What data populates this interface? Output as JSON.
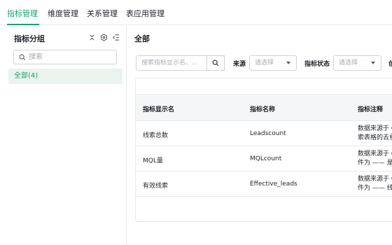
{
  "topnav": {
    "tabs": [
      {
        "label": "指标管理",
        "active": true
      },
      {
        "label": "维度管理",
        "active": false
      },
      {
        "label": "关系管理",
        "active": false
      },
      {
        "label": "表应用管理",
        "active": false
      }
    ]
  },
  "sidebar": {
    "title": "指标分组",
    "icons": [
      "collapse-all-icon",
      "settings-icon",
      "collapse-sidebar-icon"
    ],
    "search": {
      "placeholder": "搜索"
    },
    "items": [
      {
        "label": "全部(4)",
        "selected": true
      }
    ]
  },
  "main": {
    "title": "全部",
    "filters": {
      "search_placeholder": "搜索指标显示名、...",
      "source_label": "来源",
      "source_placeholder": "请选择",
      "status_label": "指标状态",
      "status_placeholder": "请选择",
      "truncated_label": "创"
    },
    "table": {
      "headers": [
        "指标显示名",
        "指标名称",
        "指标注释"
      ],
      "rows": [
        {
          "display": "线索总数",
          "name": "Leadscount",
          "note1": "数据来源于 C",
          "note2": "索表格的去重"
        },
        {
          "display": "MQL量",
          "name": "MQLcount",
          "note1": "数据来源于 C",
          "note2": "件为 —— 是否"
        },
        {
          "display": "有效线索",
          "name": "Effective_leads",
          "note1": "数据来源于 C",
          "note2": "件为 —— 线索"
        }
      ]
    }
  },
  "colors": {
    "accent": "#13a66b",
    "border": "#e6e8eb",
    "header_bg": "#f5f6f7",
    "selected_bg": "#ebf3ee"
  }
}
